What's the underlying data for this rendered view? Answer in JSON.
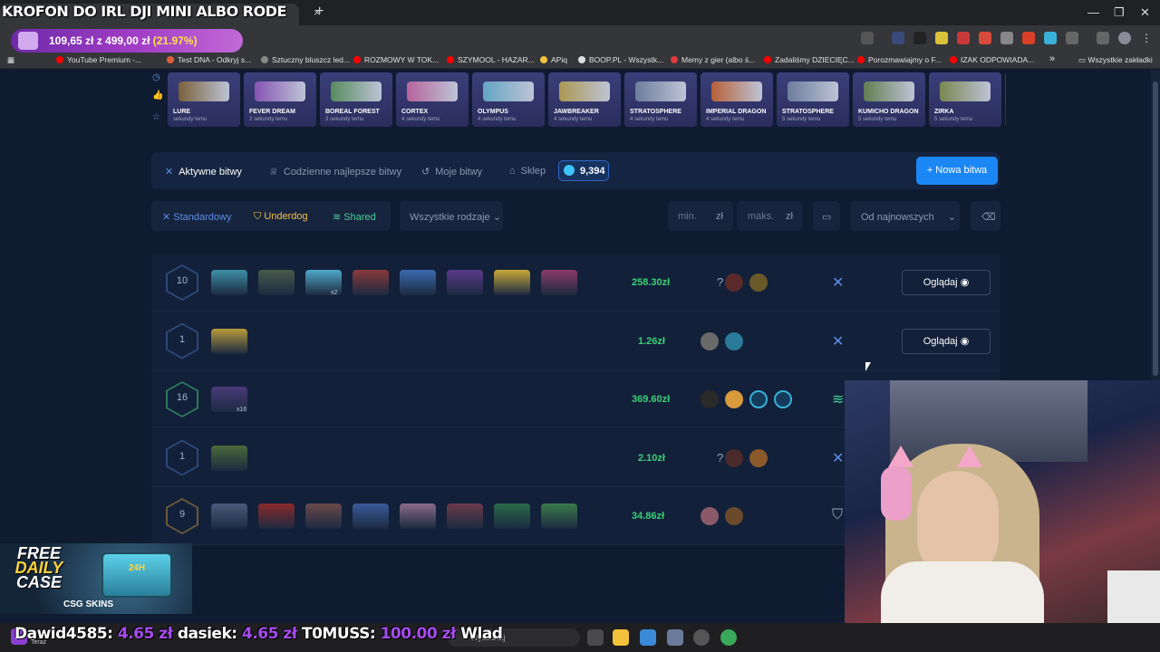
{
  "overlay": {
    "title": "KROFON DO IRL DJI MINI ALBO RODE",
    "progress_prefix": "109,65 zł z 499,00 zł",
    "progress_pct": "(21.97%)",
    "progress_fraction": 0.2197
  },
  "browser": {
    "tab_close": "×",
    "tab_new": "+",
    "window_controls": [
      "—",
      "❐",
      "✕"
    ],
    "bookmarks": [
      {
        "label": "YouTube Premium -...",
        "color": "#ff0000"
      },
      {
        "label": "Test DNA - Odkryj s...",
        "color": "#e0603a"
      },
      {
        "label": "Sztuczny bluszcz led...",
        "color": "#888888"
      },
      {
        "label": "ROZMOWY W TOK...",
        "color": "#ff0000"
      },
      {
        "label": "SZYMOOL - HAZAR...",
        "color": "#ff0000"
      },
      {
        "label": "APiq",
        "color": "#f3c23d"
      },
      {
        "label": "BOOP.PL - Wszystk...",
        "color": "#dddddd"
      },
      {
        "label": "Memy z gier (albo ś...",
        "color": "#e03a3a"
      },
      {
        "label": "Zadaliśmy DZIECIĘC...",
        "color": "#ff0000"
      },
      {
        "label": "Porozmawiajmy o F...",
        "color": "#ff0000"
      },
      {
        "label": "IZAK ODPOWIADA...",
        "color": "#ff0000"
      }
    ],
    "bookmarks_more": "»",
    "bookmarks_folder": "Wszystkie zakładki"
  },
  "drops": [
    {
      "name": "LURE",
      "ago": "sekundy temu",
      "color": "#8a6a2e"
    },
    {
      "name": "FEVER DREAM",
      "ago": "2 sekundy temu",
      "color": "#9a5bc4"
    },
    {
      "name": "BOREAL FOREST",
      "ago": "3 sekundy temu",
      "color": "#5fa05a"
    },
    {
      "name": "CORTEX",
      "ago": "4 sekundy temu",
      "color": "#d66fa8"
    },
    {
      "name": "OLYMPUS",
      "ago": "4 sekundy temu",
      "color": "#6fc0d8"
    },
    {
      "name": "JAWBREAKER",
      "ago": "4 sekundy temu",
      "color": "#c8b04a"
    },
    {
      "name": "STRATOSPHERE",
      "ago": "4 sekundy temu",
      "color": "#7a8ea8"
    },
    {
      "name": "IMPERIAL DRAGON",
      "ago": "4 sekundy temu",
      "color": "#d86a2a"
    },
    {
      "name": "STRATOSPHERE",
      "ago": "5 sekundy temu",
      "color": "#7a8ea8"
    },
    {
      "name": "KUMICHO DRAGON",
      "ago": "5 sekundy temu",
      "color": "#6f8f4a"
    },
    {
      "name": "ZIRKA",
      "ago": "5 sekundy temu",
      "color": "#8a9a4a"
    },
    {
      "name": "KI",
      "ago": "",
      "color": "#c44a4a"
    }
  ],
  "nav": {
    "tabs": [
      "Aktywne bitwy",
      "Codzienne najlepsze bitwy",
      "Moje bitwy",
      "Sklep"
    ],
    "coins": "9,394",
    "new_battle": "+ Nowa bitwa"
  },
  "filters": {
    "modes": [
      "Standardowy",
      "Underdog",
      "Shared"
    ],
    "type_select": "Wszystkie rodzaje",
    "min_label": "min.",
    "max_label": "maks.",
    "currency": "zł",
    "sort": "Od najnowszych"
  },
  "battles": [
    {
      "rounds": "10",
      "price": "258.30zł",
      "cases": [
        "#3e8fa8",
        "#4a5a4a",
        "#4fa8c8",
        "#8a3a3a",
        "#3a6ab0",
        "#5a3a8a",
        "#c8a83a",
        "#8a3a6a"
      ],
      "case_counts": {
        "2": "x2"
      },
      "players": [
        "?",
        "#5a2a2a",
        "#6a5a2a"
      ],
      "mode": "standard",
      "hex_color": "#2a4a7a",
      "watch": "Oglądaj"
    },
    {
      "rounds": "1",
      "price": "1.26zł",
      "cases": [
        "#b89a3a"
      ],
      "case_counts": {},
      "players": [
        "#6a6a6a",
        "#2a7a9a"
      ],
      "mode": "standard",
      "hex_color": "#2a4a7a",
      "watch": "Oglądaj"
    },
    {
      "rounds": "16",
      "price": "369.60zł",
      "cases": [
        "#4a3a7a"
      ],
      "case_counts": {
        "0": "x16"
      },
      "players": [
        "#2a2a2a",
        "#d89a3a",
        "bot",
        "bot"
      ],
      "mode": "shared",
      "hex_color": "#2a7a5a",
      "watch": ""
    },
    {
      "rounds": "1",
      "price": "2.10zł",
      "cases": [
        "#4a6a3a"
      ],
      "case_counts": {},
      "players": [
        "?",
        "#4a2a2a",
        "#8a5a2a"
      ],
      "mode": "standard",
      "hex_color": "#2a4a7a",
      "watch": ""
    },
    {
      "rounds": "9",
      "price": "34.86zł",
      "cases": [
        "#4a5a7a",
        "#8a2a2a",
        "#6a4a4a",
        "#3a5a9a",
        "#8a6a8a",
        "#6a3a4a",
        "#2a6a4a",
        "#3a7a4a"
      ],
      "case_counts": {},
      "players": [
        "#8a5a6a",
        "#6a4a2a"
      ],
      "mode": "underdog",
      "hex_color": "#6a5a3a",
      "watch": ""
    }
  ],
  "promo": {
    "free": "FREE",
    "daily": "DAILY",
    "case": "CASE",
    "badge": "24H",
    "brand": "CSG SKINS"
  },
  "ticker": {
    "entries": [
      {
        "user": "Dawid4585:",
        "amount": "4.65 zł"
      },
      {
        "user": "dasiek:",
        "amount": "4.65 zł"
      },
      {
        "user": "T0MUSS:",
        "amount": "100.00 zł"
      },
      {
        "user": "Wlad",
        "amount": ""
      }
    ],
    "now": "Teraz"
  },
  "taskbar": {
    "search": "Wyszukaj"
  },
  "colors": {
    "accent": "#1b87f5",
    "price_green": "#3bcf78",
    "underdog": "#f0c04a",
    "shared": "#46d19a"
  }
}
